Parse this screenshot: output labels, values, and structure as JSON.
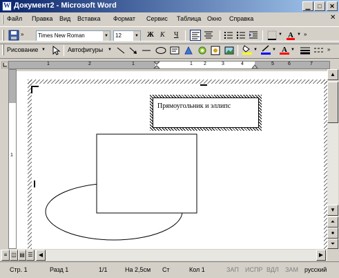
{
  "window": {
    "title": "Документ2 - Microsoft Word"
  },
  "menu": [
    "Файл",
    "Правка",
    "Вид",
    "Вставка",
    "Формат",
    "Сервис",
    "Таблица",
    "Окно",
    "Справка"
  ],
  "formatting": {
    "font": "Times New Roman",
    "size": "12",
    "bold": "Ж",
    "italic": "К",
    "underline": "Ч"
  },
  "drawing": {
    "draw_label": "Рисование",
    "autoshapes_label": "Автофигуры"
  },
  "document": {
    "textbox_text": "Прямоугольник и эллипс",
    "text_cursor": "|"
  },
  "ruler": {
    "top_labels": [
      "1",
      "2",
      "1",
      "1",
      "2",
      "3",
      "4",
      "5",
      "6",
      "7"
    ],
    "side_label": "1"
  },
  "status": {
    "page": "Стр. 1",
    "section": "Разд 1",
    "pages": "1/1",
    "at": "На 2,5см",
    "line": "Ст",
    "col": "Кол 1",
    "rec": "ЗАП",
    "trk": "ИСПР",
    "ext": "ВДЛ",
    "ovr": "ЗАМ",
    "lang": "русский"
  },
  "colors": {
    "highlight": "#ffff00",
    "line_color": "#0000ff",
    "font_color": "#ff0000",
    "title_start": "#0a246a",
    "title_end": "#a6caf0"
  }
}
